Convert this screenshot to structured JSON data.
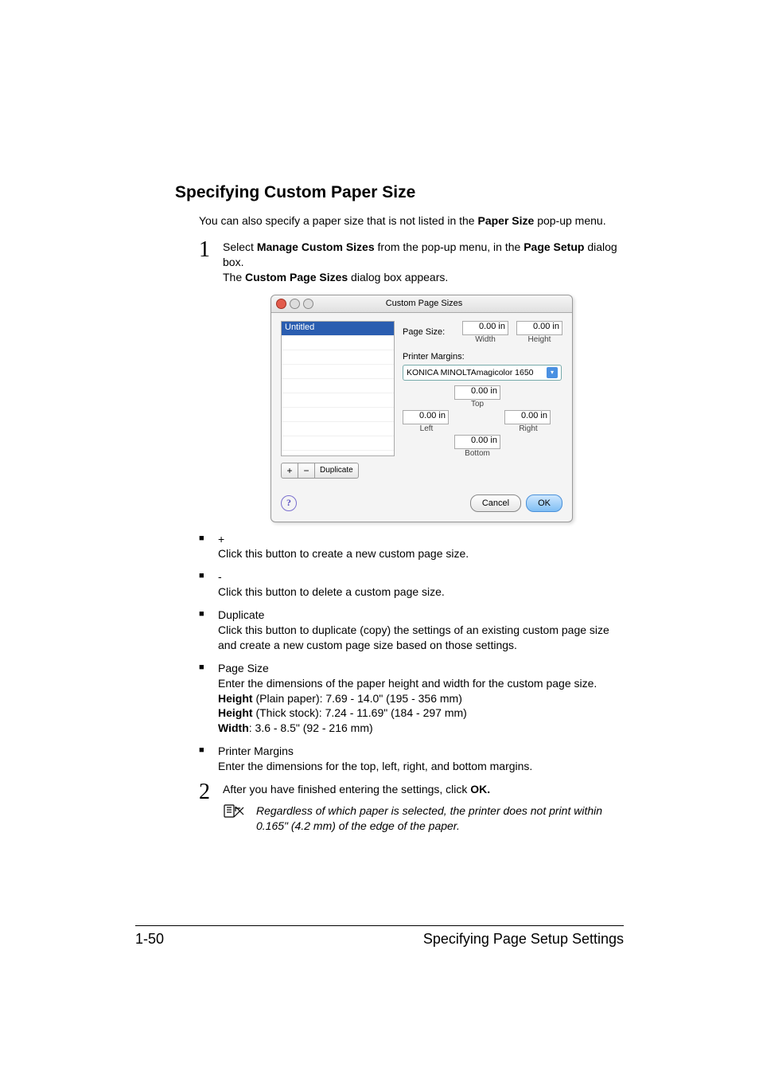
{
  "heading": "Specifying Custom Paper Size",
  "intro_pre": "You can also specify a paper size that is not listed in the ",
  "intro_bold": "Paper Size",
  "intro_post": " pop-up menu.",
  "step1": {
    "num": "1",
    "t1": "Select ",
    "b1": "Manage Custom Sizes",
    "t2": " from the pop-up menu, in the ",
    "b2": "Page Setup",
    "t3": " dialog box.",
    "line2_pre": "The ",
    "line2_bold": "Custom Page Sizes",
    "line2_post": " dialog box appears."
  },
  "dialog": {
    "title": "Custom Page Sizes",
    "list_item": "Untitled",
    "page_size_label": "Page Size:",
    "width_val": "0.00 in",
    "width_lbl": "Width",
    "height_val": "0.00 in",
    "height_lbl": "Height",
    "margins_label": "Printer Margins:",
    "printer": "KONICA MINOLTAmagicolor 1650",
    "top_val": "0.00 in",
    "top_lbl": "Top",
    "left_val": "0.00 in",
    "left_lbl": "Left",
    "right_val": "0.00 in",
    "right_lbl": "Right",
    "bottom_val": "0.00 in",
    "bottom_lbl": "Bottom",
    "plus": "+",
    "minus": "−",
    "duplicate": "Duplicate",
    "help": "?",
    "cancel": "Cancel",
    "ok": "OK"
  },
  "bullets": {
    "plus_title": "+",
    "plus_text": "Click this button to create a new custom page size.",
    "minus_title": "-",
    "minus_text": "Click this button to delete a custom page size.",
    "dup_title": "Duplicate",
    "dup_text": "Click this button to duplicate (copy) the settings of an existing custom page size and create a new custom page size based on those settings.",
    "ps_title": "Page Size",
    "ps_text": "Enter the dimensions of the paper height and width for the custom page size.",
    "ps_h1_b": "Height",
    "ps_h1_t": " (Plain paper): 7.69 - 14.0\" (195 - 356 mm)",
    "ps_h2_b": "Height",
    "ps_h2_t": " (Thick stock): 7.24 - 11.69\" (184 - 297 mm)",
    "ps_w_b": "Width",
    "ps_w_t": ":   3.6 - 8.5\" (92 - 216 mm)",
    "pm_title": "Printer Margins",
    "pm_text": "Enter the dimensions for the top, left, right, and bottom margins."
  },
  "step2": {
    "num": "2",
    "t1": "After you have finished entering the settings, click ",
    "b1": "OK."
  },
  "note": "Regardless of which paper is selected, the printer does not print within 0.165\" (4.2 mm) of the edge of the paper.",
  "footer": {
    "page_num": "1-50",
    "section": "Specifying Page Setup Settings"
  }
}
